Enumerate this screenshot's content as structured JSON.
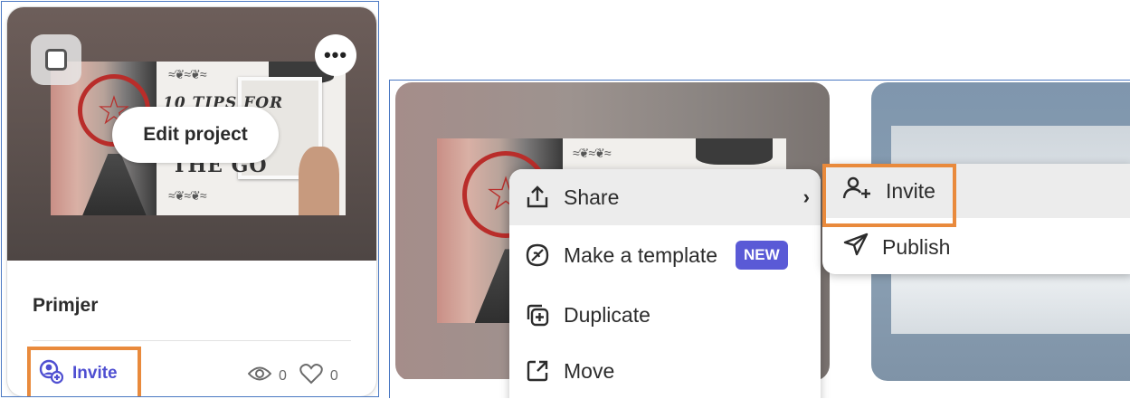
{
  "left_card": {
    "title": "Primjer",
    "edit_label": "Edit project",
    "more_label": "•••",
    "invite_label": "Invite",
    "views": "0",
    "likes": "0",
    "thumb_text": "10 TIPS FOR",
    "thumb_text2": "THE GO"
  },
  "menu": {
    "share": "Share",
    "make_template": "Make a template",
    "new_badge": "NEW",
    "duplicate": "Duplicate",
    "move": "Move"
  },
  "submenu": {
    "invite": "Invite",
    "publish": "Publish"
  },
  "colors": {
    "accent_invite": "#4f4fd1",
    "highlight_box": "#e98a3c",
    "badge": "#5a5ad6",
    "panel_border": "#4a78c2"
  }
}
